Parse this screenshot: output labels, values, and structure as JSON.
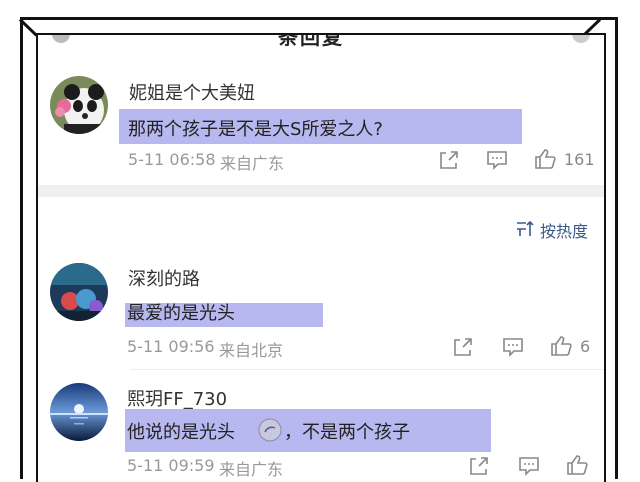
{
  "header": {
    "title": "条回复"
  },
  "sort": {
    "label": "按热度"
  },
  "comments": [
    {
      "user": "妮姐是个大美妞",
      "text": "那两个孩子是不是大S所爱之人?",
      "date": "5-11 06:58",
      "location": "来自广东",
      "likes": "161"
    },
    {
      "user": "深刻的路",
      "text": "最爱的是光头",
      "date": "5-11 09:56",
      "location": "来自北京",
      "likes": "6"
    },
    {
      "user": "熙玥FF_730",
      "text": "他说的是光头",
      "text_suffix": "，不是两个孩子",
      "date": "5-11 09:59",
      "location": "来自广东",
      "likes": ""
    }
  ],
  "colors": {
    "highlight": "#8c8ce6",
    "accent": "#3a5a8a",
    "meta": "#999999"
  },
  "icons": [
    "share-icon",
    "comment-icon",
    "like-icon",
    "sort-icon",
    "emoji-icon"
  ]
}
